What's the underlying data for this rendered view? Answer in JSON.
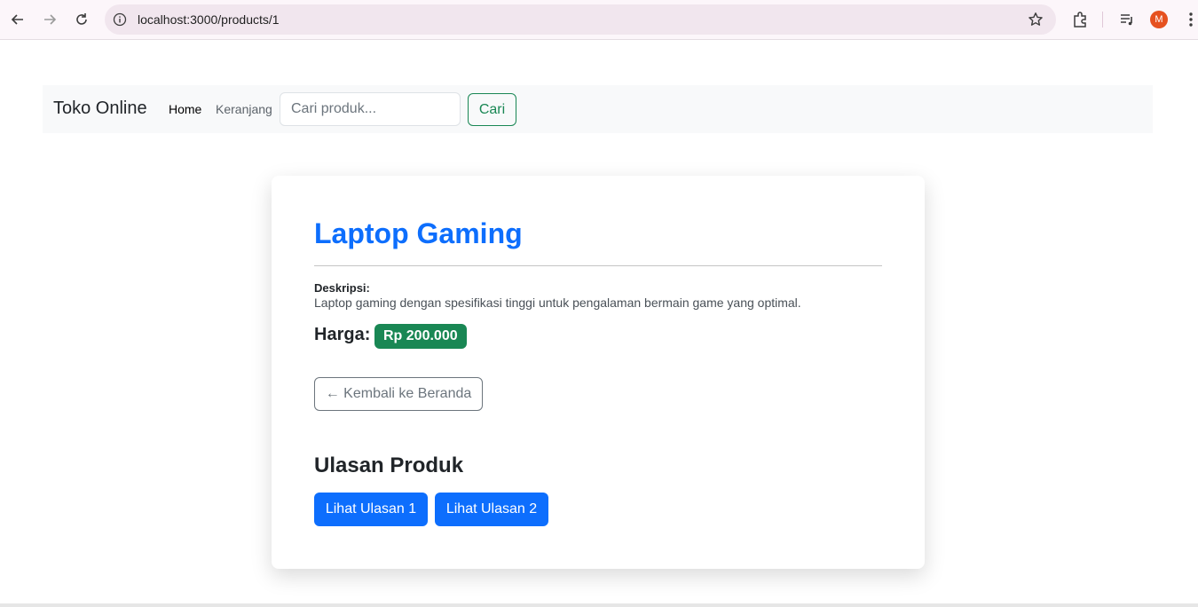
{
  "browser": {
    "url": "localhost:3000/products/1",
    "avatar_letter": "M"
  },
  "navbar": {
    "brand": "Toko Online",
    "links": [
      "Home",
      "Keranjang"
    ],
    "search_placeholder": "Cari produk...",
    "search_button": "Cari"
  },
  "product": {
    "title": "Laptop Gaming",
    "description_label": "Deskripsi:",
    "description": "Laptop gaming dengan spesifikasi tinggi untuk pengalaman bermain game yang optimal.",
    "price_label": "Harga:",
    "price": "Rp 200.000",
    "back_button": "← Kembali ke Beranda"
  },
  "reviews": {
    "title": "Ulasan Produk",
    "buttons": [
      "Lihat Ulasan 1",
      "Lihat Ulasan 2"
    ]
  },
  "colors": {
    "primary": "#0d6efd",
    "success": "#198754",
    "secondary": "#6c757d"
  }
}
